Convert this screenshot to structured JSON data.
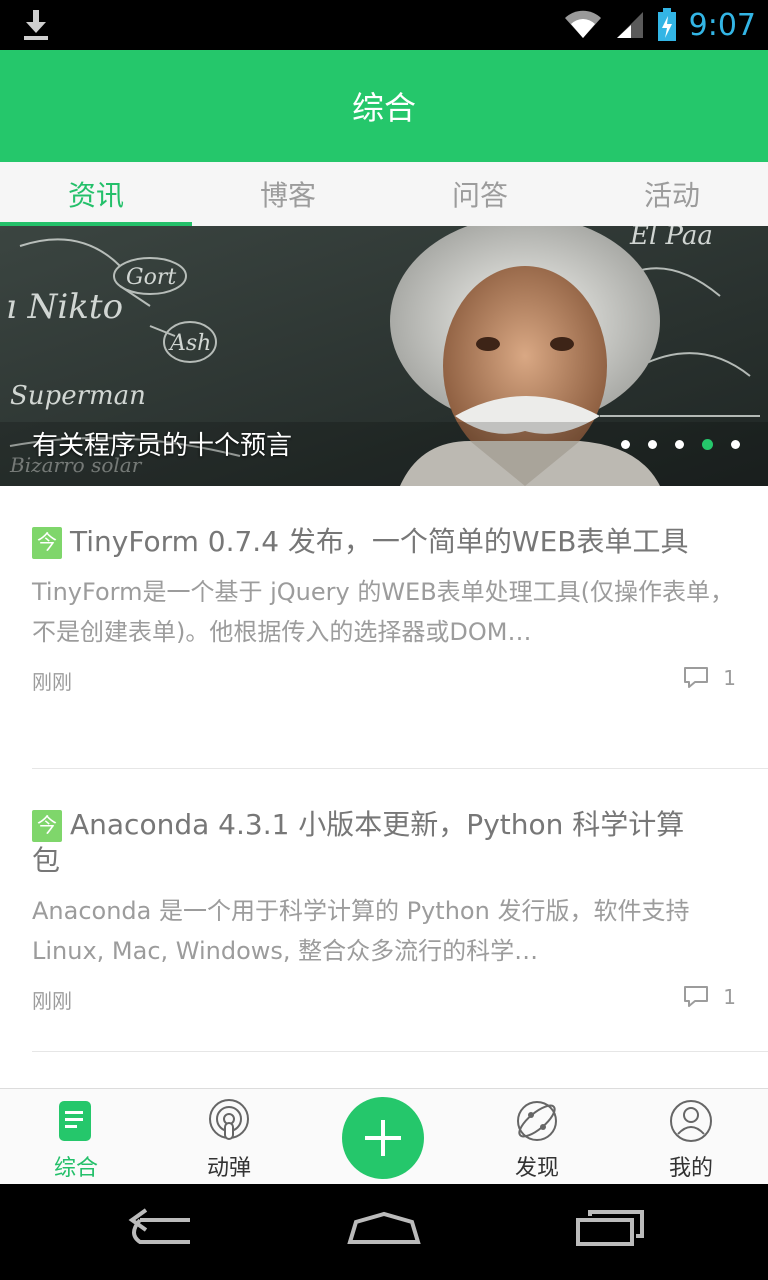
{
  "status_bar": {
    "time": "9:07",
    "icons": [
      "download-icon",
      "wifi-icon",
      "signal-icon",
      "battery-charging-icon"
    ]
  },
  "header": {
    "title": "综合"
  },
  "tabs": [
    {
      "label": "资讯",
      "active": true
    },
    {
      "label": "博客",
      "active": false
    },
    {
      "label": "问答",
      "active": false
    },
    {
      "label": "活动",
      "active": false
    }
  ],
  "banner": {
    "title": "有关程序员的十个预言",
    "page_count": 5,
    "active_index": 3
  },
  "articles": [
    {
      "badge": "今",
      "title": "TinyForm 0.7.4 发布，一个简单的WEB表单工具",
      "summary": "TinyForm是一个基于 jQuery 的WEB表单处理工具(仅操作表单，不是创建表单)。他根据传入的选择器或DOM…",
      "time": "刚刚",
      "comments": "1"
    },
    {
      "badge": "今",
      "title": "Anaconda 4.3.1 小版本更新，Python 科学计算包",
      "summary": "Anaconda 是一个用于科学计算的 Python 发行版，软件支持 Linux, Mac, Windows, 整合众多流行的科学…",
      "time": "刚刚",
      "comments": "1"
    }
  ],
  "bottom_nav": [
    {
      "label": "综合",
      "icon": "news-icon",
      "active": true
    },
    {
      "label": "动弹",
      "icon": "tweet-icon",
      "active": false
    },
    {
      "label": "",
      "icon": "add-icon",
      "active": false
    },
    {
      "label": "发现",
      "icon": "explore-icon",
      "active": false
    },
    {
      "label": "我的",
      "icon": "profile-icon",
      "active": false
    }
  ],
  "colors": {
    "brand": "#25c76b",
    "tab_inactive": "#9c9c9c",
    "status_time": "#33b5e5"
  }
}
